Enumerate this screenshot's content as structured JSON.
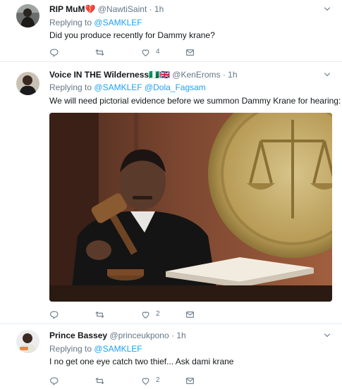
{
  "tweets": [
    {
      "name": "RIP MuM💔",
      "handle": "@NawtiSaint",
      "time": "· 1h",
      "replying_to": "Replying to",
      "mentions": "@SAMKLEF",
      "text": "Did you produce recently for Dammy krane?",
      "likes": "4"
    },
    {
      "name": "Voice IN THE Wilderness🇳🇬🇬🇧",
      "handle": "@KenEroms",
      "time": "· 1h",
      "replying_to": "Replying to",
      "mentions": "@SAMKLEF @Dola_Fagsam",
      "text": "We will need pictorial evidence before we summon Dammy Krane for hearing:",
      "likes": "2"
    },
    {
      "name": "Prince Bassey",
      "handle": "@princeukpono",
      "time": "· 1h",
      "replying_to": "Replying to",
      "mentions": "@SAMKLEF",
      "text": "I no get one eye catch two thief... Ask dami krane",
      "likes": "2"
    }
  ],
  "icons": {
    "reply": "reply-icon",
    "retweet": "retweet-icon",
    "like": "heart-icon",
    "message": "envelope-icon",
    "more": "chevron-down-icon"
  },
  "colors": {
    "link": "#1da1f2",
    "muted": "#657786",
    "text": "#14171a",
    "divider": "#e6ecf0"
  }
}
